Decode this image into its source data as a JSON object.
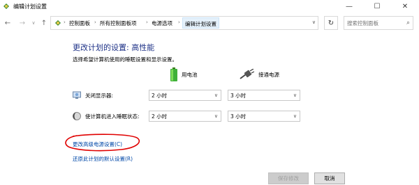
{
  "window": {
    "title": "编辑计划设置",
    "min_icon": "minimize-icon",
    "max_icon": "maximize-icon",
    "close_icon": "close-icon"
  },
  "nav": {
    "breadcrumbs": [
      "控制面板",
      "所有控制面板项",
      "电源选项",
      "编辑计划设置"
    ],
    "search_placeholder": "搜索控制面板"
  },
  "main": {
    "heading": "更改计划的设置: 高性能",
    "subtext": "选择希望计算机使用的睡眠设置和显示设置。",
    "col_battery": "用电池",
    "col_plugged": "接通电源",
    "rows": [
      {
        "label": "关闭显示器:",
        "battery": "2 小时",
        "plugged": "3 小时"
      },
      {
        "label": "使计算机进入睡眠状态:",
        "battery": "2 小时",
        "plugged": "3 小时"
      }
    ],
    "link_advanced": "更改高级电源设置(C)",
    "link_restore": "还原此计划的默认设置(R)"
  },
  "footer": {
    "save_label": "保存修改",
    "cancel_label": "取消"
  },
  "colors": {
    "heading": "#1e3287",
    "link": "#0048a8",
    "annotation": "#e00000"
  }
}
